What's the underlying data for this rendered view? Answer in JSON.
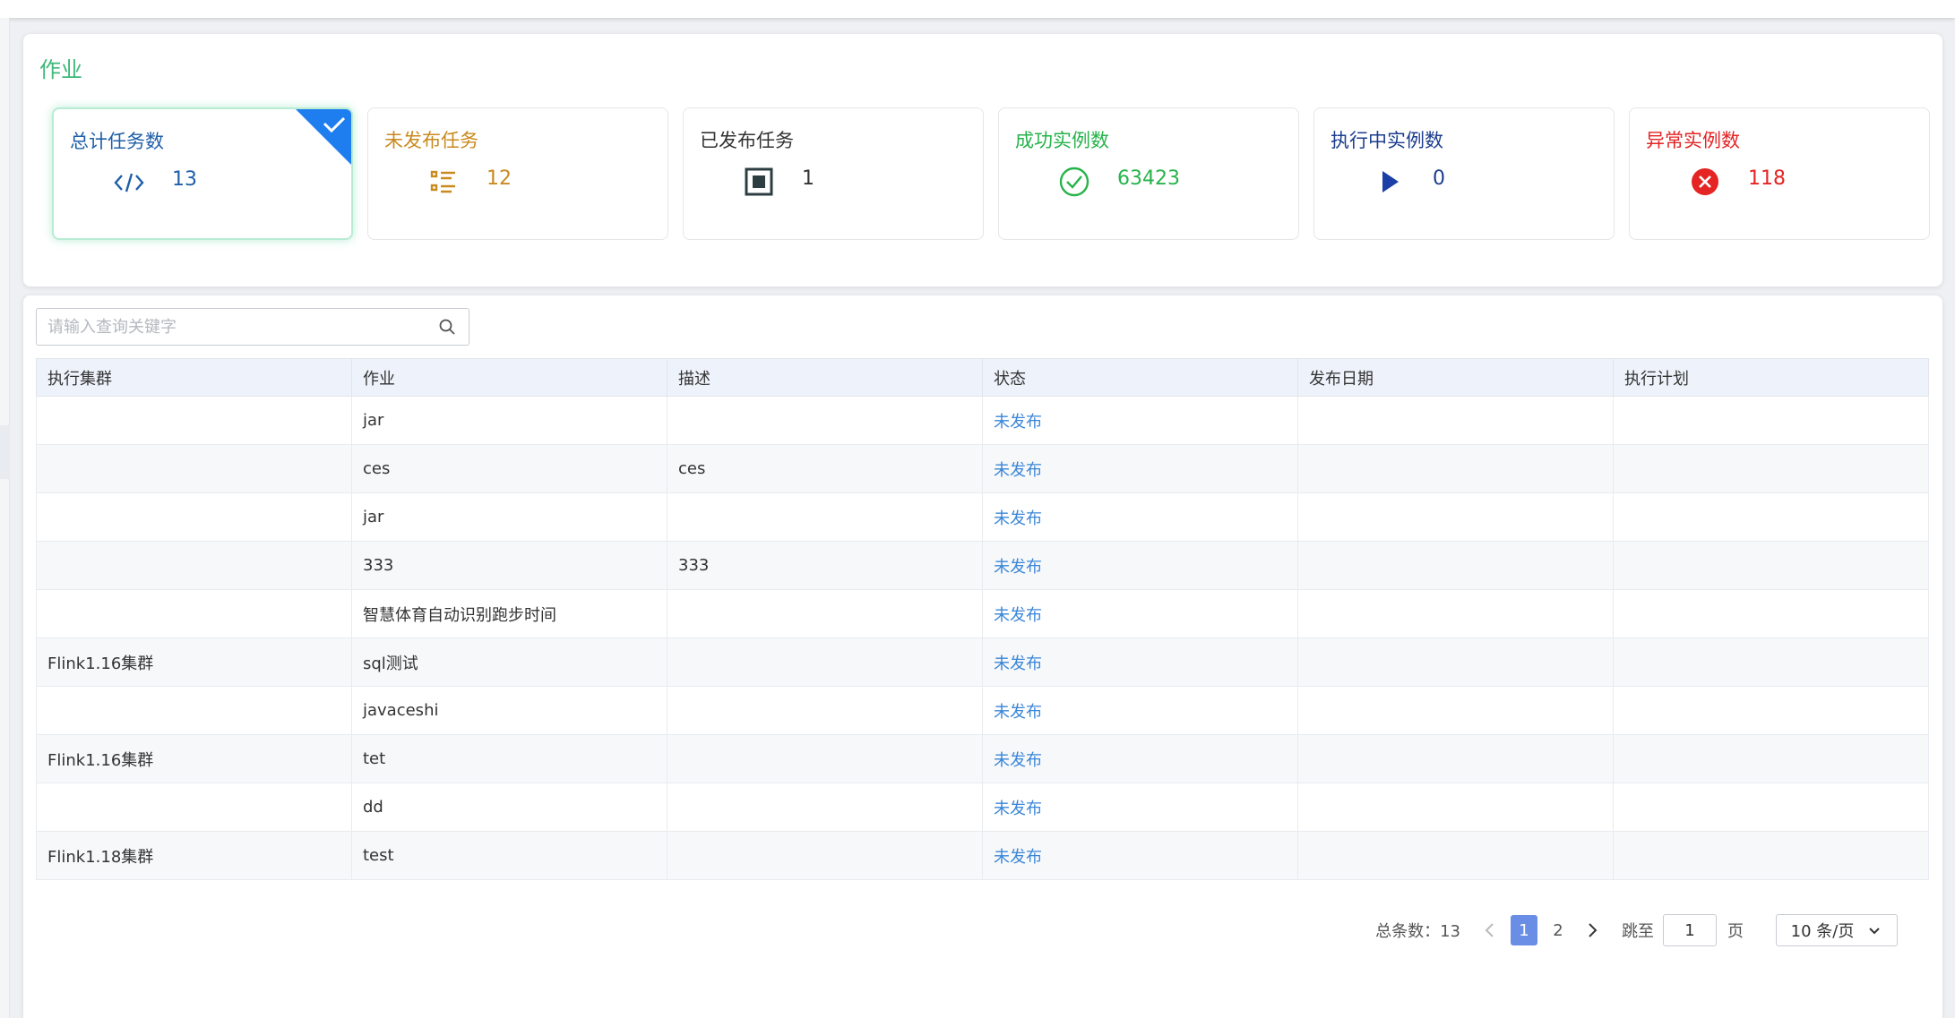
{
  "section": {
    "title": "作业"
  },
  "cards": [
    {
      "label": "总计任务数",
      "value": "13",
      "icon": "code-icon",
      "color": "#1f5fa8",
      "active": true
    },
    {
      "label": "未发布任务",
      "value": "12",
      "icon": "list-icon",
      "color": "#c98a1e"
    },
    {
      "label": "已发布任务",
      "value": "1",
      "icon": "stop-icon",
      "color": "#333333"
    },
    {
      "label": "成功实例数",
      "value": "63423",
      "icon": "check-circle-icon",
      "color": "#27b34b"
    },
    {
      "label": "执行中实例数",
      "value": "0",
      "icon": "play-icon",
      "color": "#1c3d8f"
    },
    {
      "label": "异常实例数",
      "value": "118",
      "icon": "error-circle-icon",
      "color": "#e52424"
    }
  ],
  "search": {
    "placeholder": "请输入查询关键字"
  },
  "table": {
    "columns": [
      "执行集群",
      "作业",
      "描述",
      "状态",
      "发布日期",
      "执行计划"
    ],
    "rows": [
      {
        "cluster": "",
        "job": "jar",
        "desc": "",
        "status": "未发布",
        "date": "",
        "plan": ""
      },
      {
        "cluster": "",
        "job": "ces",
        "desc": "ces",
        "status": "未发布",
        "date": "",
        "plan": ""
      },
      {
        "cluster": "",
        "job": "jar",
        "desc": "",
        "status": "未发布",
        "date": "",
        "plan": ""
      },
      {
        "cluster": "",
        "job": "333",
        "desc": "333",
        "status": "未发布",
        "date": "",
        "plan": ""
      },
      {
        "cluster": "",
        "job": "智慧体育自动识别跑步时间",
        "desc": "",
        "status": "未发布",
        "date": "",
        "plan": ""
      },
      {
        "cluster": "Flink1.16集群",
        "job": "sql测试",
        "desc": "",
        "status": "未发布",
        "date": "",
        "plan": ""
      },
      {
        "cluster": "",
        "job": "javaceshi",
        "desc": "",
        "status": "未发布",
        "date": "",
        "plan": ""
      },
      {
        "cluster": "Flink1.16集群",
        "job": "tet",
        "desc": "",
        "status": "未发布",
        "date": "",
        "plan": ""
      },
      {
        "cluster": "",
        "job": "dd",
        "desc": "",
        "status": "未发布",
        "date": "",
        "plan": ""
      },
      {
        "cluster": "Flink1.18集群",
        "job": "test",
        "desc": "",
        "status": "未发布",
        "date": "",
        "plan": ""
      }
    ]
  },
  "pagination": {
    "total_label": "总条数：13",
    "pages": [
      "1",
      "2"
    ],
    "current": "1",
    "jump_label": "跳至",
    "jump_value": "1",
    "page_unit": "页",
    "page_size": "10 条/页"
  },
  "colors": {
    "accent": "#3db87a",
    "link": "#3a86d8",
    "corner": "#1e7ef0",
    "pager_active": "#6a8ee6"
  }
}
